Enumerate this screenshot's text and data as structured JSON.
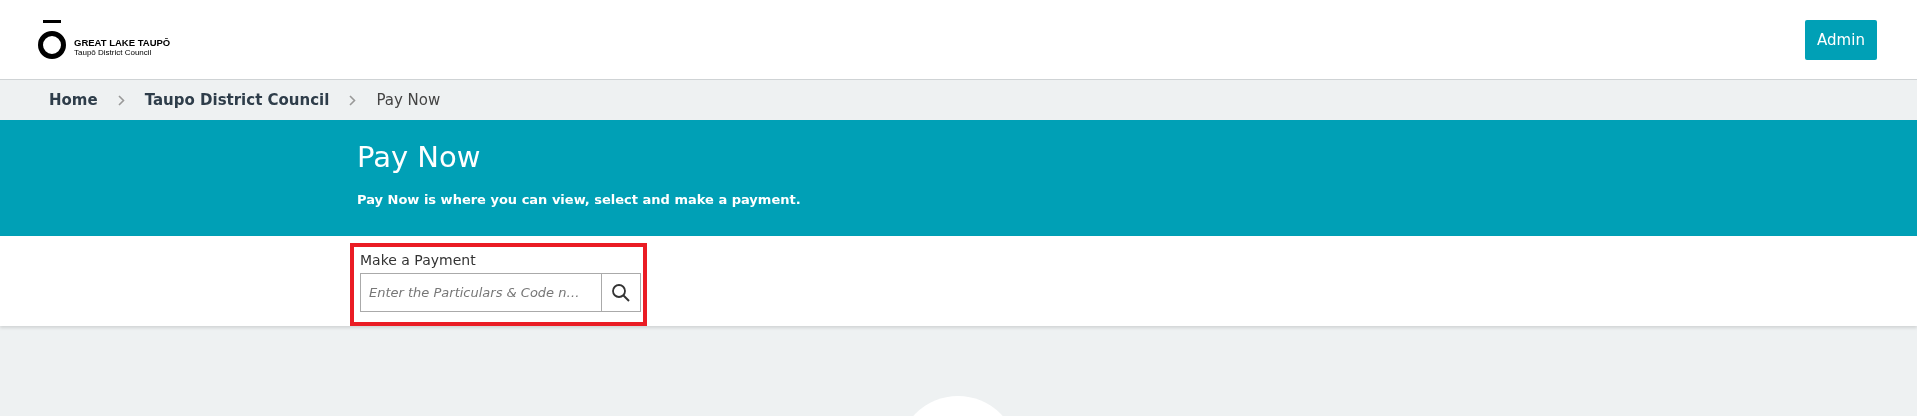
{
  "header": {
    "logo": {
      "name": "GREAT LAKE TAUPŌ",
      "subtitle": "Taupō District Council"
    },
    "admin_button": "Admin"
  },
  "breadcrumbs": [
    {
      "label": "Home",
      "current": false
    },
    {
      "label": "Taupo District Council",
      "current": false
    },
    {
      "label": "Pay Now",
      "current": true
    }
  ],
  "banner": {
    "title": "Pay Now",
    "description": "Pay Now is where you can view, select and make a payment."
  },
  "payment": {
    "label": "Make a Payment",
    "placeholder": "Enter the Particulars & Code n…",
    "highlighted": true
  }
}
